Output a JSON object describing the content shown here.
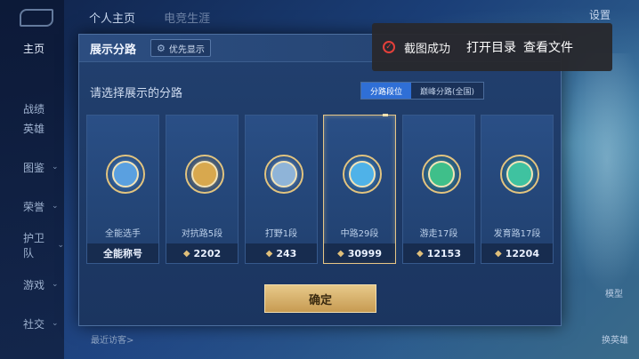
{
  "topnav": {
    "tabs": [
      "个人主页",
      "电竞生涯"
    ],
    "settings": "设置"
  },
  "sidebar": {
    "items": [
      {
        "label": "主页",
        "chevron": false
      },
      {
        "label": "战绩",
        "chevron": false
      },
      {
        "label": "英雄",
        "chevron": false
      },
      {
        "label": "图鉴",
        "chevron": true
      },
      {
        "label": "荣誉",
        "chevron": true
      },
      {
        "label": "护卫队",
        "chevron": true
      },
      {
        "label": "游戏",
        "chevron": true
      },
      {
        "label": "社交",
        "chevron": true
      }
    ]
  },
  "right_panel": {
    "model_label": "模型",
    "switch_hero_label": "换英雄"
  },
  "bottom": {
    "visitors_label": "最近访客>"
  },
  "modal": {
    "title": "展示分路",
    "priority_label": "优先显示",
    "prompt": "请选择展示的分路",
    "toggle": {
      "option_a": "分路段位",
      "option_b": "巅峰分路(全国)"
    },
    "cards": [
      {
        "name": "全能选手",
        "value": "全能称号",
        "icon": "allround-emblem-icon",
        "color": "#5aa0e0",
        "selected": false,
        "has_diamond": false
      },
      {
        "name": "对抗路5段",
        "value": "2202",
        "icon": "clash-lane-emblem-icon",
        "color": "#d8a84e",
        "selected": false,
        "has_diamond": true
      },
      {
        "name": "打野1段",
        "value": "243",
        "icon": "jungle-emblem-icon",
        "color": "#8fb4d8",
        "selected": false,
        "has_diamond": true
      },
      {
        "name": "中路29段",
        "value": "30999",
        "icon": "mid-lane-emblem-icon",
        "color": "#4fb2e8",
        "selected": true,
        "has_diamond": true
      },
      {
        "name": "游走17段",
        "value": "12153",
        "icon": "roam-emblem-icon",
        "color": "#3fbf8a",
        "selected": false,
        "has_diamond": true
      },
      {
        "name": "发育路17段",
        "value": "12204",
        "icon": "farm-lane-emblem-icon",
        "color": "#3fc2a0",
        "selected": false,
        "has_diamond": true
      }
    ],
    "confirm_label": "确定"
  },
  "toast": {
    "message": "截图成功",
    "open_folder": "打开目录",
    "view_file": "查看文件"
  }
}
